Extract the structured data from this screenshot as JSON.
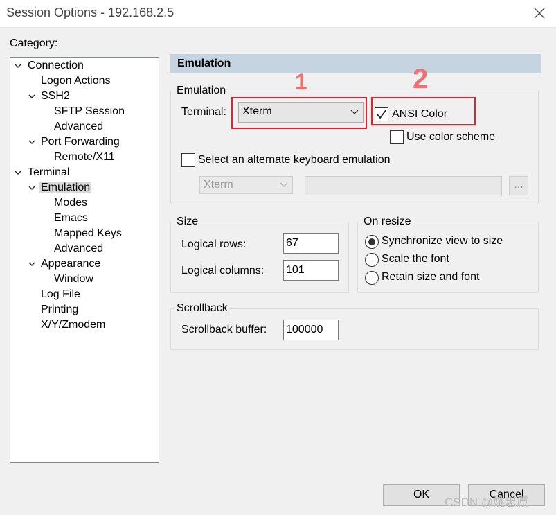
{
  "window": {
    "title": "Session Options - 192.168.2.5"
  },
  "sidebar": {
    "label": "Category:",
    "items": [
      {
        "label": "Connection",
        "expanded": true
      },
      {
        "label": "Logon Actions"
      },
      {
        "label": "SSH2",
        "expanded": true
      },
      {
        "label": "SFTP Session"
      },
      {
        "label": "Advanced"
      },
      {
        "label": "Port Forwarding",
        "expanded": true
      },
      {
        "label": "Remote/X11"
      },
      {
        "label": "Terminal",
        "expanded": true
      },
      {
        "label": "Emulation",
        "expanded": true,
        "selected": true
      },
      {
        "label": "Modes"
      },
      {
        "label": "Emacs"
      },
      {
        "label": "Mapped Keys"
      },
      {
        "label": "Advanced"
      },
      {
        "label": "Appearance",
        "expanded": true
      },
      {
        "label": "Window"
      },
      {
        "label": "Log File"
      },
      {
        "label": "Printing"
      },
      {
        "label": "X/Y/Zmodem"
      }
    ]
  },
  "panel": {
    "header": "Emulation",
    "emulation": {
      "group_label": "Emulation",
      "terminal_label": "Terminal:",
      "terminal_value": "Xterm",
      "ansi_color_label": "ANSI Color",
      "ansi_color_checked": true,
      "color_scheme_label": "Use color scheme",
      "color_scheme_checked": false,
      "alt_keyboard_label": "Select an alternate keyboard emulation",
      "alt_keyboard_checked": false,
      "alt_keyboard_value": "Xterm",
      "alt_keyboard_text": "",
      "browse_label": "..."
    },
    "size": {
      "group_label": "Size",
      "rows_label": "Logical rows:",
      "rows_value": "67",
      "columns_label": "Logical columns:",
      "columns_value": "101"
    },
    "on_resize": {
      "group_label": "On resize",
      "options": [
        "Synchronize view to size",
        "Scale the font",
        "Retain size and font"
      ],
      "selected": "Synchronize view to size"
    },
    "scrollback": {
      "group_label": "Scrollback",
      "buffer_label": "Scrollback buffer:",
      "buffer_value": "100000"
    }
  },
  "buttons": {
    "ok": "OK",
    "cancel": "Cancel"
  },
  "annotations": {
    "first": "1",
    "second": "2",
    "highlight_color": "#e8202a"
  },
  "watermark": "CSDN @姚忠原"
}
